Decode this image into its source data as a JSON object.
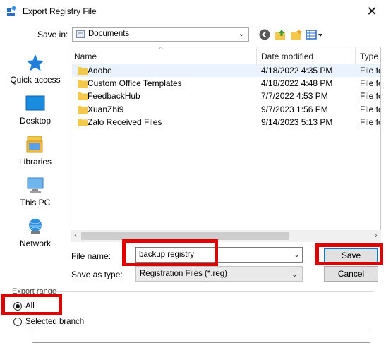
{
  "window": {
    "title": "Export Registry File",
    "close_glyph": "✕"
  },
  "save_in": {
    "label": "Save in:",
    "value": "Documents"
  },
  "toolbar": {
    "icons": [
      "back-icon",
      "up-folder-icon",
      "new-folder-icon",
      "view-menu-icon"
    ]
  },
  "places": [
    {
      "label": "Quick access",
      "icon": "star-icon"
    },
    {
      "label": "Desktop",
      "icon": "desktop-icon"
    },
    {
      "label": "Libraries",
      "icon": "libraries-icon"
    },
    {
      "label": "This PC",
      "icon": "computer-icon"
    },
    {
      "label": "Network",
      "icon": "network-icon"
    }
  ],
  "file_list": {
    "columns": [
      "Name",
      "Date modified",
      "Type"
    ],
    "rows": [
      {
        "name": "Adobe",
        "date": "4/18/2022 4:35 PM",
        "type": "File fo",
        "selected": true
      },
      {
        "name": "Custom Office Templates",
        "date": "4/18/2022 4:48 PM",
        "type": "File fo",
        "selected": false
      },
      {
        "name": "FeedbackHub",
        "date": "7/7/2022 4:53 PM",
        "type": "File fo",
        "selected": false
      },
      {
        "name": "XuanZhi9",
        "date": "9/7/2023 1:56 PM",
        "type": "File fo",
        "selected": false
      },
      {
        "name": "Zalo Received Files",
        "date": "9/14/2023 5:13 PM",
        "type": "File fo",
        "selected": false
      }
    ]
  },
  "form": {
    "file_name_label": "File name:",
    "file_name_value": "backup registry",
    "save_as_type_label": "Save as type:",
    "save_as_type_value": "Registration Files (*.reg)"
  },
  "buttons": {
    "save": "Save",
    "cancel": "Cancel"
  },
  "export_range": {
    "label": "Export range",
    "all_label": "All",
    "selected_branch_label": "Selected branch",
    "selected": "all",
    "branch_value": ""
  },
  "colors": {
    "highlight": "#e00000",
    "folder": "#f3c84b",
    "accent": "#0078d7"
  }
}
